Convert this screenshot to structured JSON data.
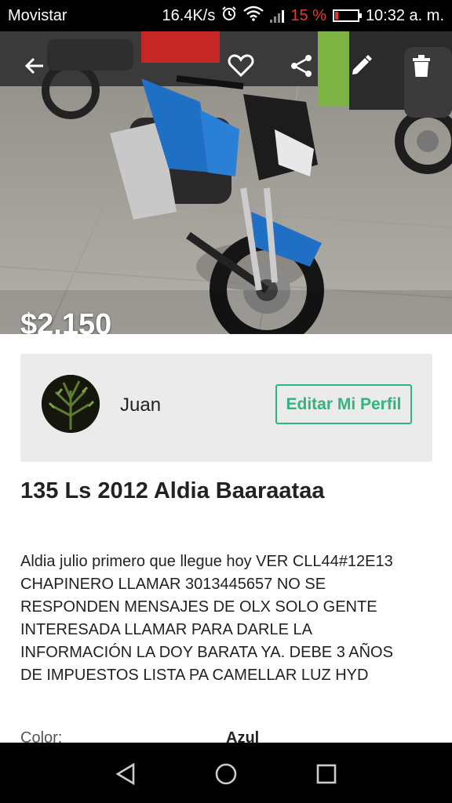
{
  "status_bar": {
    "carrier": "Movistar",
    "net_speed": "16.4K/s",
    "battery_percent": "15 %",
    "battery_level": 0.15,
    "time": "10:32 a. m.",
    "icons": [
      "alarm-icon",
      "wifi-icon",
      "signal-icon",
      "battery-icon"
    ]
  },
  "toolbar": {
    "icons": [
      "back-arrow-icon",
      "heart-icon",
      "share-icon",
      "edit-pencil-icon",
      "trash-icon"
    ]
  },
  "listing": {
    "price": "$2.150",
    "title": "135 Ls 2012 Aldia Baaraataa",
    "description_lines": [
      "Aldia julio primero que llegue hoy VER CLL44#12E13",
      "CHAPINERO LLAMAR 3013445657 NO SE",
      "RESPONDEN MENSAJES DE OLX SOLO GENTE",
      "INTERESADA LLAMAR PARA DARLE LA",
      "INFORMACIÓN LA DOY BARATA YA. DEBE 3 AÑOS",
      "DE IMPUESTOS LISTA PA CAMELLAR LUZ HYD"
    ],
    "details": [
      {
        "label": "Color:",
        "value": "Azul"
      }
    ]
  },
  "seller": {
    "name": "Juan",
    "edit_button_label": "Editar Mi Perfil"
  },
  "colors": {
    "accent_green": "#2eb67d",
    "card_bg": "#ebebeb",
    "battery_low": "#e53935",
    "bike_blue": "#1f6fc4"
  },
  "nav_bar": {
    "icons": [
      "back-triangle-icon",
      "home-circle-icon",
      "recents-square-icon"
    ]
  }
}
